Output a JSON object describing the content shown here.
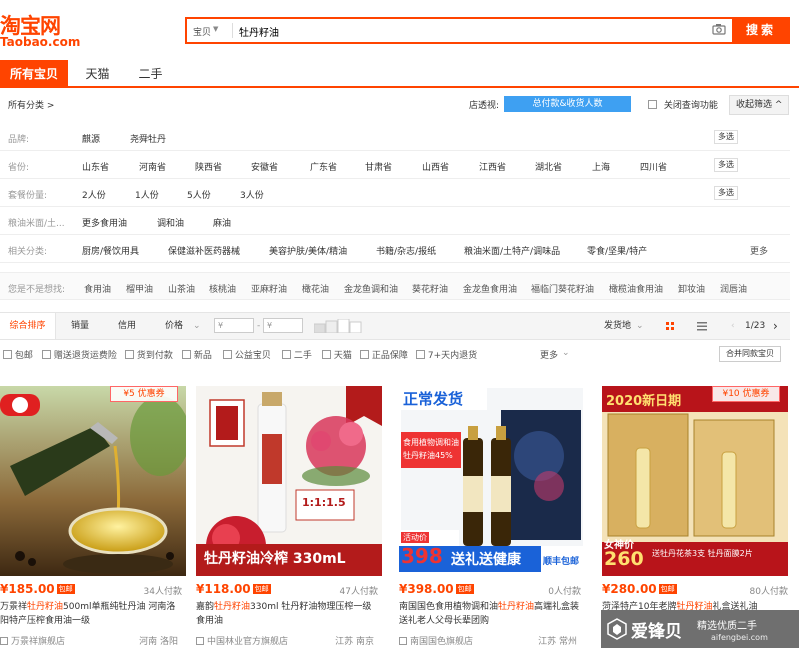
{
  "brand": {
    "logo_cn": "淘宝网",
    "logo_en": "Taobao.com",
    "accent": "#ff4400"
  },
  "search": {
    "scope": "宝贝",
    "query": "牡丹籽油",
    "button": "搜索"
  },
  "tabs": [
    "所有宝贝",
    "天猫",
    "二手"
  ],
  "filter_header": {
    "all_categories": "所有分类 >",
    "shop_view": "店透视:",
    "shop_bar": "总付款&收货人数",
    "close_query": "关闭查询功能",
    "collapse": "收起筛选 ^"
  },
  "filter_rows": [
    {
      "label": "品牌:",
      "options": [
        "麒源",
        "尧舜牡丹"
      ],
      "more": "多选"
    },
    {
      "label": "省份:",
      "options": [
        "山东省",
        "河南省",
        "陕西省",
        "安徽省",
        "广东省",
        "甘肃省",
        "山西省",
        "江西省",
        "湖北省",
        "上海",
        "四川省"
      ],
      "more": "多选"
    },
    {
      "label": "套餐份量:",
      "options": [
        "2人份",
        "1人份",
        "5人份",
        "3人份"
      ],
      "more": "多选"
    },
    {
      "label": "粮油米面/土...",
      "options": [
        "更多食用油",
        "调和油",
        "麻油"
      ],
      "more": ""
    },
    {
      "label": "相关分类:",
      "options": [
        "厨房/餐饮用具",
        "保健滋补医药器械",
        "美容护肤/美体/精油",
        "书籍/杂志/报纸",
        "粮油米面/土特产/调味品",
        "零食/坚果/特产"
      ],
      "more": "更多"
    }
  ],
  "guess": {
    "label": "您是不是想找:",
    "options": [
      "食用油",
      "榴甲油",
      "山茶油",
      "核桃油",
      "亚麻籽油",
      "橄花油",
      "金龙鱼调和油",
      "葵花籽油",
      "金龙鱼食用油",
      "福临门葵花籽油",
      "橄榄油食用油",
      "卸妆油",
      "润唇油"
    ]
  },
  "sortbar": {
    "items": [
      "综合排序",
      "销量",
      "信用",
      "价格"
    ],
    "price_from": "¥",
    "price_to": "¥",
    "ship_from": "发货地",
    "page": "1/23"
  },
  "options2": {
    "items": [
      "包邮",
      "赠送退货运费险",
      "货到付款",
      "新品",
      "公益宝贝",
      "二手",
      "天猫",
      "正品保障",
      "7+天内退货"
    ],
    "more": "更多",
    "merge": "合并同款宝贝"
  },
  "products": [
    {
      "price": "¥185.00",
      "tag": "包邮",
      "sold": "34人付款",
      "title_pre": "万景祥",
      "title_hl": "牡丹籽油",
      "title_post": "500ml单瓶纯牡丹油 河南洛阳特产压榨食用油一级",
      "shop": "万景祥旗舰店",
      "loc": "河南 洛阳",
      "coupon": "¥5 优惠券",
      "img_text": ""
    },
    {
      "price": "¥118.00",
      "tag": "包邮",
      "sold": "47人付款",
      "title_pre": "嘉韵",
      "title_hl": "牡丹籽油",
      "title_post": "330ml 牡丹籽油物理压榨一级食用油",
      "shop": "中国林业官方旗舰店",
      "loc": "江苏 南京",
      "coupon": "",
      "img_text": "牡丹籽油冷榨 330mL",
      "img_sub": "1:1:1.5"
    },
    {
      "price": "¥398.00",
      "tag": "包邮",
      "sold": "0人付款",
      "title_pre": "南国国色食用植物调和油",
      "title_hl": "牡丹籽油",
      "title_post": "高端礼盒装送礼老人父母长辈团购",
      "shop": "南国国色旗舰店",
      "loc": "江苏 常州",
      "coupon": "",
      "img_text": "正常发货",
      "img_badge": "398",
      "img_banner": "送礼送健康",
      "img_corner": "顺丰包邮",
      "img_label": "食用植物调和油 牡丹籽油45%",
      "img_act": "活动价"
    },
    {
      "price": "¥280.00",
      "tag": "包邮",
      "sold": "80人付款",
      "title_pre": "菏泽特产10年老牌",
      "title_hl": "牡丹籽油",
      "title_post": "礼盒送礼油",
      "shop": "",
      "loc": "",
      "coupon": "¥10 优惠券",
      "img_text": "2020新日期",
      "img_badge": "260",
      "img_act": "女神价",
      "img_banner": "送牡丹花茶3支 牡丹面膜2片"
    }
  ],
  "watermark": {
    "cn": "爱锋贝",
    "slogan": "精选优质二手",
    "url": "aifengbei.com"
  }
}
